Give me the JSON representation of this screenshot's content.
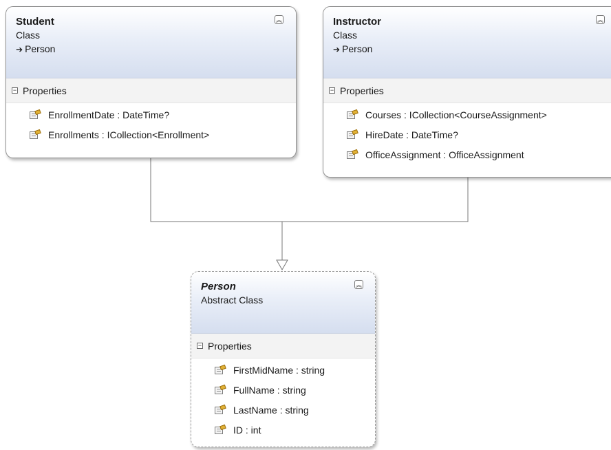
{
  "classes": {
    "student": {
      "name": "Student",
      "kind": "Class",
      "base": "Person",
      "section": "Properties",
      "properties": [
        "EnrollmentDate : DateTime?",
        "Enrollments : ICollection<Enrollment>"
      ]
    },
    "instructor": {
      "name": "Instructor",
      "kind": "Class",
      "base": "Person",
      "section": "Properties",
      "properties": [
        "Courses : ICollection<CourseAssignment>",
        "HireDate : DateTime?",
        "OfficeAssignment : OfficeAssignment"
      ]
    },
    "person": {
      "name": "Person",
      "kind": "Abstract Class",
      "section": "Properties",
      "properties": [
        "FirstMidName : string",
        "FullName : string",
        "LastName : string",
        "ID : int"
      ]
    }
  },
  "icons": {
    "collapse": "double-chevron-up-icon",
    "section_toggle": "minus-box-icon",
    "property": "property-icon",
    "inheritance": "arrow-right-icon"
  },
  "colors": {
    "header_gradient_top": "#ffffff",
    "header_gradient_bottom": "#d5deef",
    "border": "#8f8f8f",
    "connector": "#777777"
  }
}
